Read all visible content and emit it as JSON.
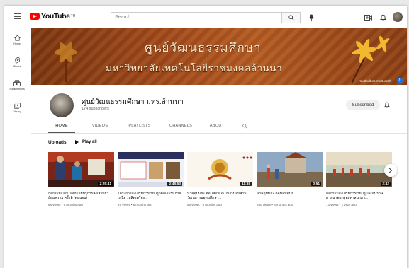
{
  "app": {
    "logo_text": "YouTube",
    "logo_country": "TH",
    "search_placeholder": "Search"
  },
  "guide": [
    {
      "label": "Home",
      "icon": "home-icon"
    },
    {
      "label": "Shorts",
      "icon": "shorts-icon"
    },
    {
      "label": "Subscriptions",
      "icon": "subscriptions-icon"
    },
    {
      "label": "Library",
      "icon": "library-icon"
    }
  ],
  "banner": {
    "line1": "ศูนย์วัฒนธรรมศึกษา",
    "line2": "มหาวิทยาลัยเทคโนโลยีราชมงคลล้านนา",
    "url": "rmutlculture.rmutl.ac.th"
  },
  "channel": {
    "name": "ศูนย์วัฒนธรรมศึกษา มทร.ล้านนา",
    "subscribers": "174 subscribers",
    "subscribe_label": "Subscribed"
  },
  "tabs": [
    "HOME",
    "VIDEOS",
    "PLAYLISTS",
    "CHANNELS",
    "ABOUT"
  ],
  "active_tab": "HOME",
  "section": {
    "title": "Uploads",
    "play_all": "Play all"
  },
  "videos": [
    {
      "title": "กิจกรรมแลกเปลี่ยนเรียนรู้การส่งเสริมผ้าย้อมคราม ครั้งที่ (ตอนจบ)",
      "duration": "2:29:41",
      "meta": "68 views • 5 months ago"
    },
    {
      "title": "โครงการส่งเสริมการเรียนรู้วัฒนธรรมภาคเหนือ : ผลิตเครื่อง...",
      "duration": "2:48:53",
      "meta": "29 views • 8 months ago"
    },
    {
      "title": "นาคอุปัมภะ ตอนสัมพันธ์ ในงานสืบสานวัฒนธรรมอุดมศึกษา...",
      "duration": "11:38",
      "meta": "56 views • 8 months ago"
    },
    {
      "title": "นาคอุปัมภะ ตอนสัมพันธ์",
      "duration": "0:51",
      "meta": "280 views • 8 months ago"
    },
    {
      "title": "กิจกรรมส่งเสริมการเรียนรู้และอนุรักษ์ศาสนาพระพุทธศาสนาภา...",
      "duration": "2:42",
      "meta": "73 views • 1 year ago"
    }
  ],
  "colors": {
    "brand_red": "#ff0000",
    "banner_brown": "#a0481a"
  }
}
